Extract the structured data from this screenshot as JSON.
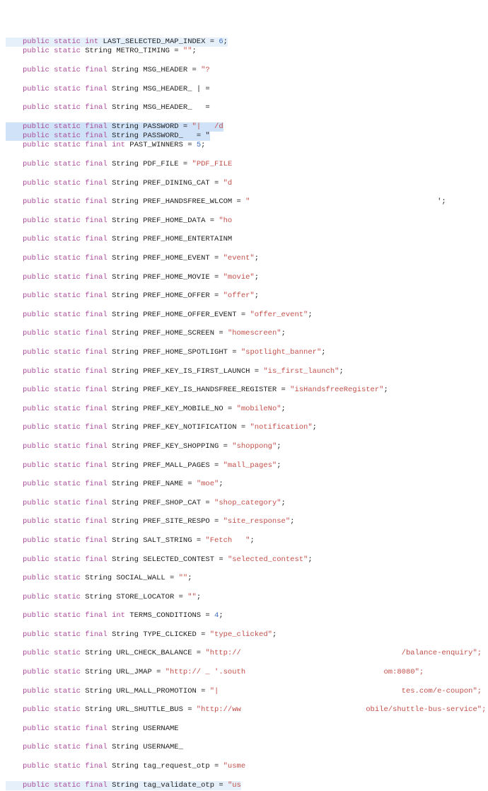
{
  "lines": [
    {
      "kind": "int_lit_top",
      "hl": "hl2",
      "kw": "public static",
      "type": "int",
      "name": "LAST_SELECTED_MAP_INDEX",
      "value": "6",
      "semi": ";"
    },
    {
      "kind": "str_empty",
      "kw": "public static",
      "type": "String",
      "name": "METRO_TIMING",
      "value": "\"\"",
      "semi": ";"
    },
    {
      "kind": "str_open",
      "kw": "public static final",
      "type": "String",
      "name": "MSG_HEADER",
      "value": "\"?"
    },
    {
      "kind": "no_val",
      "kw": "public static final",
      "type": "String",
      "name": "MSG_HEADER_",
      "tail": "| ="
    },
    {
      "kind": "no_val",
      "kw": "public static final",
      "type": "String",
      "name": "MSG_HEADER_",
      "tail": "  ="
    },
    {
      "kind": "str_open",
      "hl": "hl",
      "kw": "public static final",
      "type": "String",
      "name": "PASSWORD",
      "value": "\"|   /d"
    },
    {
      "kind": "str_open",
      "hl": "hl",
      "kw": "public static final",
      "type": "String",
      "name": "PASSWORD_",
      "tail": "   = \""
    },
    {
      "kind": "int_lit",
      "kw": "public static final",
      "type": "int",
      "name": "PAST_WINNERS",
      "value": "5",
      "semi": ";"
    },
    {
      "kind": "str_open",
      "kw": "public static final",
      "type": "String",
      "name": "PDF_FILE",
      "value": "\"PDF_FILE"
    },
    {
      "kind": "str_open",
      "kw": "public static final",
      "type": "String",
      "name": "PREF_DINING_CAT",
      "value": "\"d"
    },
    {
      "kind": "str_open_tail",
      "kw": "public static final",
      "type": "String",
      "name": "PREF_HANDSFREE_WLCOM",
      "value": "\"",
      "trail": "                                          ';"
    },
    {
      "kind": "str_open",
      "kw": "public static final",
      "type": "String",
      "name": "PREF_HOME_DATA",
      "value": "\"ho"
    },
    {
      "kind": "no_val",
      "kw": "public static final",
      "type": "String",
      "name": "PREF_HOME_ENTERTAINM"
    },
    {
      "kind": "str_lit",
      "kw": "public static final",
      "type": "String",
      "name": "PREF_HOME_EVENT",
      "value": "\"event\"",
      "semi": ";"
    },
    {
      "kind": "str_lit",
      "kw": "public static final",
      "type": "String",
      "name": "PREF_HOME_MOVIE",
      "value": "\"movie\"",
      "semi": ";"
    },
    {
      "kind": "str_lit",
      "kw": "public static final",
      "type": "String",
      "name": "PREF_HOME_OFFER",
      "value": "\"offer\"",
      "semi": ";"
    },
    {
      "kind": "str_lit",
      "kw": "public static final",
      "type": "String",
      "name": "PREF_HOME_OFFER_EVENT",
      "value": "\"offer_event\"",
      "semi": ";"
    },
    {
      "kind": "str_lit",
      "kw": "public static final",
      "type": "String",
      "name": "PREF_HOME_SCREEN",
      "value": "\"homescreen\"",
      "semi": ";"
    },
    {
      "kind": "str_lit",
      "kw": "public static final",
      "type": "String",
      "name": "PREF_HOME_SPOTLIGHT",
      "value": "\"spotlight_banner\"",
      "semi": ";"
    },
    {
      "kind": "str_lit",
      "kw": "public static final",
      "type": "String",
      "name": "PREF_KEY_IS_FIRST_LAUNCH",
      "value": "\"is_first_launch\"",
      "semi": ";"
    },
    {
      "kind": "str_lit",
      "kw": "public static final",
      "type": "String",
      "name": "PREF_KEY_IS_HANDSFREE_REGISTER",
      "value": "\"isHandsfreeRegister\"",
      "semi": ";"
    },
    {
      "kind": "str_lit",
      "kw": "public static final",
      "type": "String",
      "name": "PREF_KEY_MOBILE_NO",
      "value": "\"mobileNo\"",
      "semi": ";"
    },
    {
      "kind": "str_lit",
      "kw": "public static final",
      "type": "String",
      "name": "PREF_KEY_NOTIFICATION",
      "value": "\"notification\"",
      "semi": ";"
    },
    {
      "kind": "str_lit",
      "kw": "public static final",
      "type": "String",
      "name": "PREF_KEY_SHOPPING",
      "value": "\"shoppong\"",
      "semi": ";"
    },
    {
      "kind": "str_lit",
      "kw": "public static final",
      "type": "String",
      "name": "PREF_MALL_PAGES",
      "value": "\"mall_pages\"",
      "semi": ";"
    },
    {
      "kind": "str_lit",
      "kw": "public static final",
      "type": "String",
      "name": "PREF_NAME",
      "value": "\"moe\"",
      "semi": ";"
    },
    {
      "kind": "str_lit",
      "kw": "public static final",
      "type": "String",
      "name": "PREF_SHOP_CAT",
      "value": "\"shop_category\"",
      "semi": ";"
    },
    {
      "kind": "str_lit",
      "kw": "public static final",
      "type": "String",
      "name": "PREF_SITE_RESPO",
      "value": "\"site_response\"",
      "semi": ";"
    },
    {
      "kind": "str_lit",
      "kw": "public static final",
      "type": "String",
      "name": "SALT_STRING",
      "value": "\"Fetch   \"",
      "semi": ";"
    },
    {
      "kind": "str_lit",
      "kw": "public static final",
      "type": "String",
      "name": "SELECTED_CONTEST",
      "value": "\"selected_contest\"",
      "semi": ";"
    },
    {
      "kind": "str_empty",
      "kw": "public static",
      "type": "String",
      "name": "SOCIAL_WALL",
      "value": "\"\"",
      "semi": ";"
    },
    {
      "kind": "str_empty",
      "kw": "public static",
      "type": "String",
      "name": "STORE_LOCATOR",
      "value": "\"\"",
      "semi": ";"
    },
    {
      "kind": "int_lit",
      "kw": "public static final",
      "type": "int",
      "name": "TERMS_CONDITIONS",
      "value": "4",
      "semi": ";"
    },
    {
      "kind": "str_lit",
      "kw": "public static final",
      "type": "String",
      "name": "TYPE_CLICKED",
      "value": "\"type_clicked\"",
      "semi": ";"
    },
    {
      "kind": "url_gap",
      "kw": "public static",
      "type": "String",
      "name": "URL_CHECK_BALANCE",
      "left": "\"http://",
      "right": "/balance-enquiry\";",
      "gap": "                                    "
    },
    {
      "kind": "url_gap",
      "kw": "public static",
      "type": "String",
      "name": "URL_JMAP",
      "left": "\"http:// _ '.south",
      "right": "om:8080\";",
      "gap": "                               "
    },
    {
      "kind": "url_gap",
      "kw": "public static",
      "type": "String",
      "name": "URL_MALL_PROMOTION",
      "left": "\"|",
      "right": "tes.com/e-coupon\";",
      "gap": "                                         "
    },
    {
      "kind": "url_gap",
      "kw": "public static",
      "type": "String",
      "name": "URL_SHUTTLE_BUS",
      "left": "\"http://ww",
      "right": "obile/shuttle-bus-service\";",
      "gap": "                            "
    },
    {
      "kind": "decl_only",
      "kw": "public static final",
      "type": "String",
      "name": "USERNAME"
    },
    {
      "kind": "decl_only",
      "kw": "public static final",
      "type": "String",
      "name": "USERNAME_"
    },
    {
      "kind": "str_open",
      "kw": "public static final",
      "type": "String",
      "name": "tag_request_otp",
      "value": "\"usme"
    },
    {
      "kind": "str_open",
      "hl": "hl2",
      "kw": "public static final",
      "type": "String",
      "name": "tag_validate_otp",
      "value": "\"us"
    }
  ]
}
